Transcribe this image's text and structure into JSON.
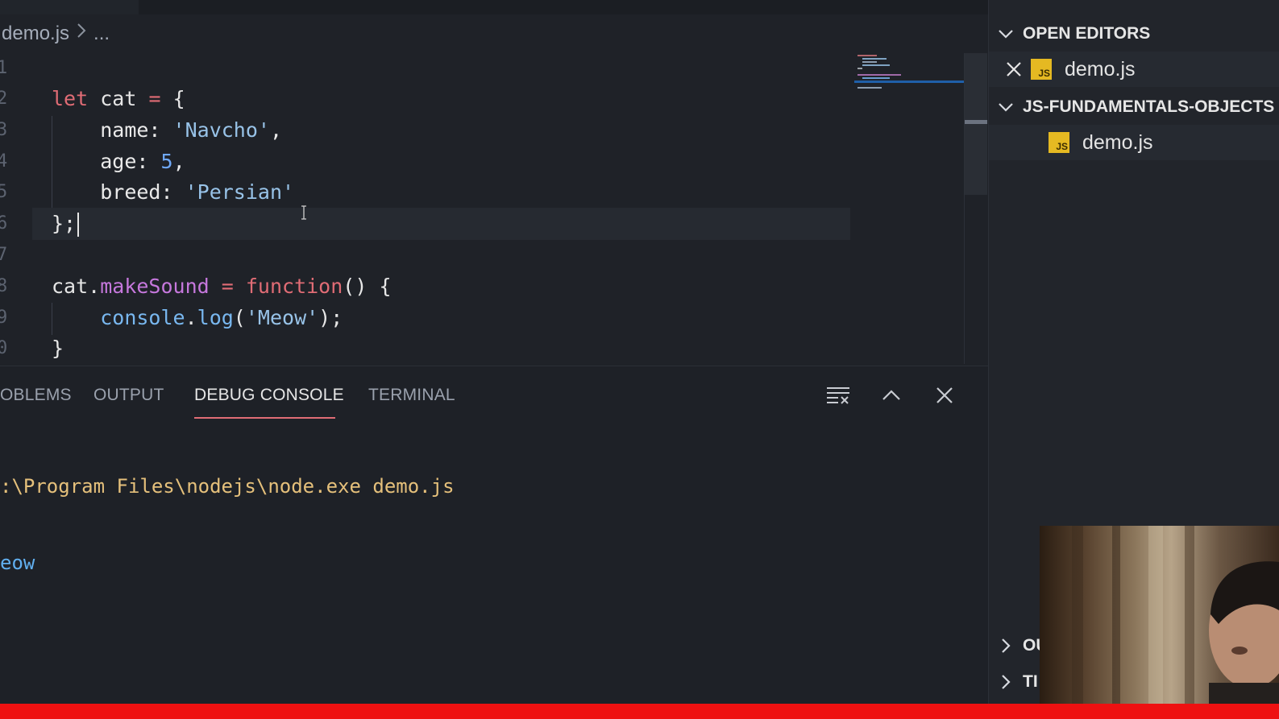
{
  "breadcrumb": {
    "file": "demo.js",
    "more": "..."
  },
  "editor": {
    "line_numbers": [
      "1",
      "2",
      "3",
      "4",
      "5",
      "6",
      "7",
      "8",
      "9",
      "0"
    ],
    "code": {
      "l2": {
        "kw": "let",
        "name": "cat",
        "eq": "=",
        "open": "{"
      },
      "l3": {
        "key": "name:",
        "val": "'Navcho'",
        "comma": ","
      },
      "l4": {
        "key": "age:",
        "val": "5",
        "comma": ","
      },
      "l5": {
        "key": "breed:",
        "val": "'Persian'"
      },
      "l6": {
        "close": "};"
      },
      "l8": {
        "obj": "cat",
        "dot": ".",
        "method": "makeSound",
        "eq": "=",
        "fn": "function",
        "parens": "()",
        "open": "{"
      },
      "l9": {
        "obj": "console",
        "dot": ".",
        "method": "log",
        "open": "(",
        "arg": "'Meow'",
        "close": ");"
      },
      "l10": {
        "close": "}"
      }
    }
  },
  "panel": {
    "tabs": [
      {
        "label": "OBLEMS"
      },
      {
        "label": "OUTPUT"
      },
      {
        "label": "DEBUG CONSOLE"
      },
      {
        "label": "TERMINAL"
      }
    ],
    "active_tab": "DEBUG CONSOLE",
    "buttons": [
      "clear-console-icon",
      "maximize-panel-icon",
      "close-panel-icon"
    ],
    "console": {
      "command": ":\\Program Files\\nodejs\\node.exe demo.js",
      "output": "eow"
    }
  },
  "sidebar": {
    "open_editors": {
      "title": "OPEN EDITORS",
      "file": "demo.js",
      "icon_label": "JS"
    },
    "folder": {
      "title": "JS-FUNDAMENTALS-OBJECTS",
      "file": "demo.js",
      "icon_label": "JS"
    },
    "collapsed": [
      {
        "title": "OU"
      },
      {
        "title": "TI"
      }
    ]
  },
  "colors": {
    "keyword": "#e06c75",
    "string": "#98c3e8",
    "number": "#6fa8f7",
    "function": "#c678dd",
    "console_command": "#e5c07b",
    "console_output": "#61afef",
    "accent_tab": "#e06c75",
    "js_icon": "#e5b922"
  }
}
